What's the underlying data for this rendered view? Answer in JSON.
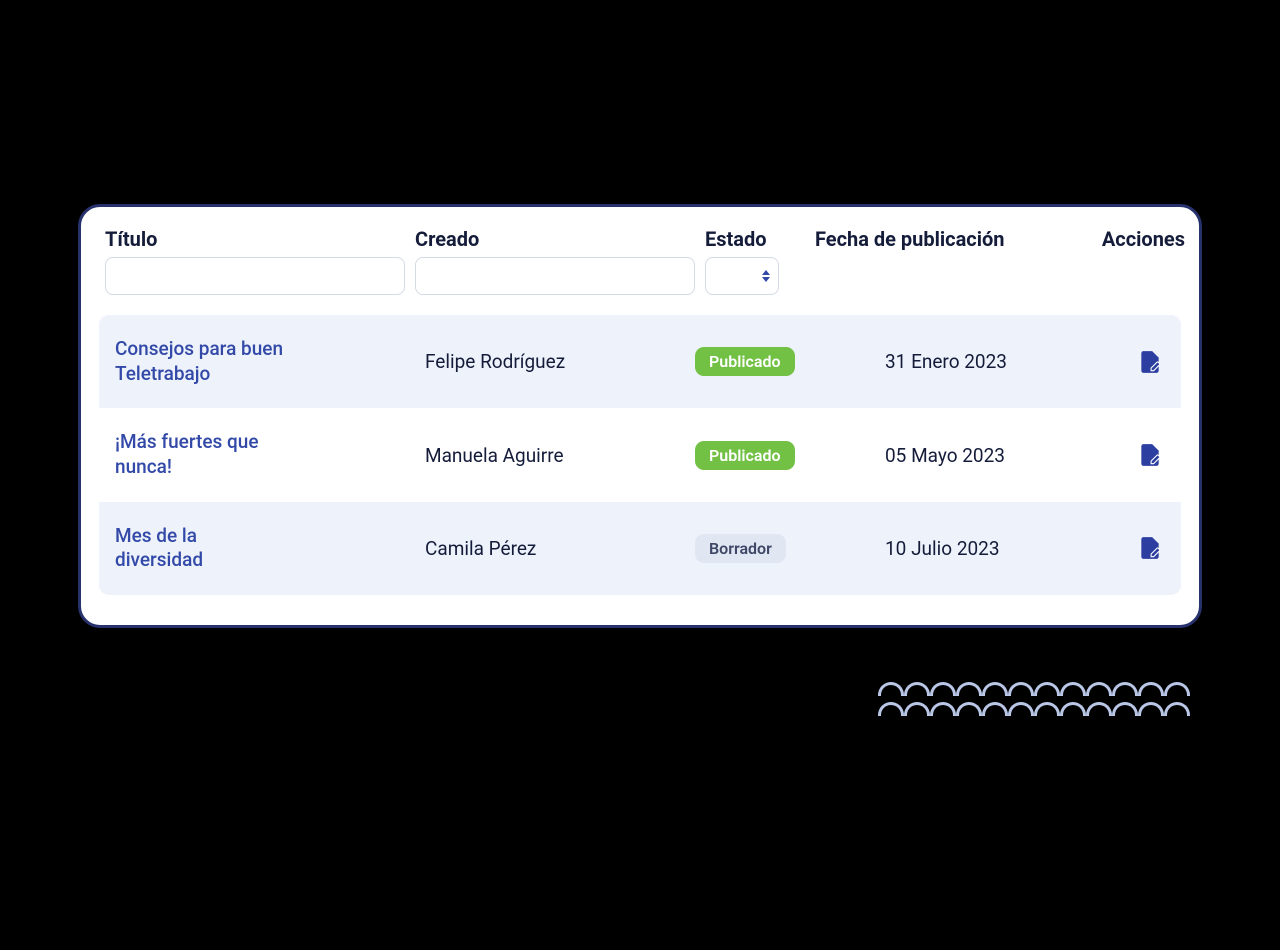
{
  "columns": {
    "title": "Título",
    "created": "Creado",
    "status": "Estado",
    "pubdate": "Fecha de publicación",
    "actions": "Acciones"
  },
  "filters": {
    "title_value": "",
    "created_value": "",
    "status_value": ""
  },
  "status_labels": {
    "publicado": "Publicado",
    "borrador": "Borrador"
  },
  "rows": [
    {
      "title": "Consejos para buen Teletrabajo",
      "creator": "Felipe Rodríguez",
      "status": "publicado",
      "pubdate": "31 Enero 2023"
    },
    {
      "title": "¡Más fuertes que nunca!",
      "creator": "Manuela Aguirre",
      "status": "publicado",
      "pubdate": "05 Mayo 2023"
    },
    {
      "title": "Mes de la diversidad",
      "creator": "Camila Pérez",
      "status": "borrador",
      "pubdate": "10 Julio 2023"
    }
  ]
}
